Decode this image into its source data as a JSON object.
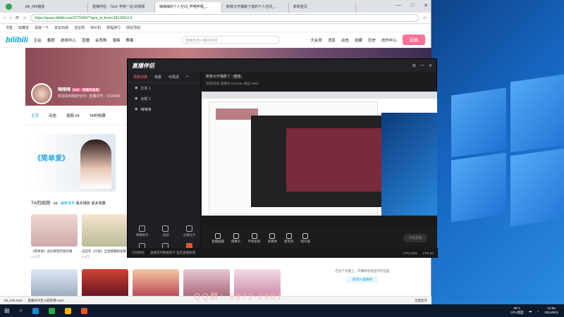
{
  "browser": {
    "tabs": [
      "bili_045播放",
      "直播伴侣 - \"Sn3: 学校一站 的视频",
      "嗨嗨嗨的个人空间_哔哩哔哩_...",
      "新鲜大开播旅了遍的个人空间_...",
      "新标签页"
    ],
    "url": "https://space.bilibili.com/37754047?spm_id_from=333.999.0.0",
    "bookmarks": [
      "书签",
      "收藏夹",
      "百度一下",
      "京东商城",
      "淘宝网",
      "特价机",
      "携程旅行",
      "网址导航"
    ],
    "nav": [
      "主站",
      "番剧",
      "游戏中心",
      "直播",
      "会员购",
      "漫画",
      "赛事",
      "投稿"
    ],
    "search_placeholder": "搜索你感兴趣的视频",
    "right_nav": [
      "大会员",
      "消息",
      "动态",
      "收藏",
      "历史",
      "创作中心"
    ],
    "upload": "投稿"
  },
  "space": {
    "username": "嗨嗨嗨",
    "level": "LV5",
    "badge": "年度大会员",
    "sign": "欢迎来到我的空间~ 直播间号：9720464",
    "tabs": [
      "主页",
      "动态",
      "投稿 54",
      "TA的收藏"
    ],
    "videos_heading": "TA的视频",
    "video_count": "48",
    "sort_options": [
      "最新发布",
      "最多播放",
      "最多收藏"
    ],
    "banner_caption": "《简单爱》",
    "videos": [
      {
        "title": "《简单爱》逗比教程花絮剪辑",
        "views": "11.5万",
        "date": "05-24"
      },
      {
        "title": "这些年《大鱼》全程跳舞超美版",
        "views": "5.6万",
        "date": "04-18"
      },
      {
        "title": "花絮合集",
        "views": "6.1万",
        "date": "03-02"
      }
    ],
    "rpanel_text": "在这个页面上，开播状态会显示在这里",
    "rpanel_btn": "前往TA直播间"
  },
  "obs": {
    "title": "直播伴侣",
    "scene_tabs": [
      "场景切换",
      "场景",
      "可再添"
    ],
    "sources": [
      "文本 1",
      "台帮 1",
      "嗨嗨嗨"
    ],
    "live_title": "新鲜大开播旅了",
    "live_btn": "修改",
    "live_meta": [
      "游戏/其他",
      "直播间 9720464",
      "粉丝 5463"
    ],
    "tools": [
      {
        "label": "弹幕助手",
        "hot": false
      },
      {
        "label": "美颜",
        "hot": false
      },
      {
        "label": "主播任务",
        "hot": false
      },
      {
        "label": "PK连麦",
        "hot": false
      },
      {
        "label": "大乱斗",
        "hot": false
      },
      {
        "label": "送礼物",
        "hot": true
      },
      {
        "label": "投票",
        "hot": false
      },
      {
        "label": "抽奖",
        "hot": true
      },
      {
        "label": "直播设置",
        "hot": false
      },
      {
        "label": "直播数据",
        "hot": false
      },
      {
        "label": "互动玩法",
        "hot": false
      },
      {
        "label": "更多",
        "hot": false
      }
    ],
    "bottom": [
      "直播画面",
      "摄像头",
      "手机投屏",
      "多媒体",
      "麦克风",
      "扬声器"
    ],
    "start": "开始直播",
    "status": [
      "已初始化",
      "直播实时数据统计 监控直播质量",
      "CPU 25%",
      "FPS 60"
    ]
  },
  "download": [
    "bili_045.mp4",
    "直播间大乱斗超刺激.mp4",
    "全部显示"
  ],
  "watermark": "QQ群：8973-2801",
  "taskbar": {
    "temp": "35°C",
    "cpu": "CPU温度",
    "time": "14:05",
    "date": "2021/8/11"
  }
}
